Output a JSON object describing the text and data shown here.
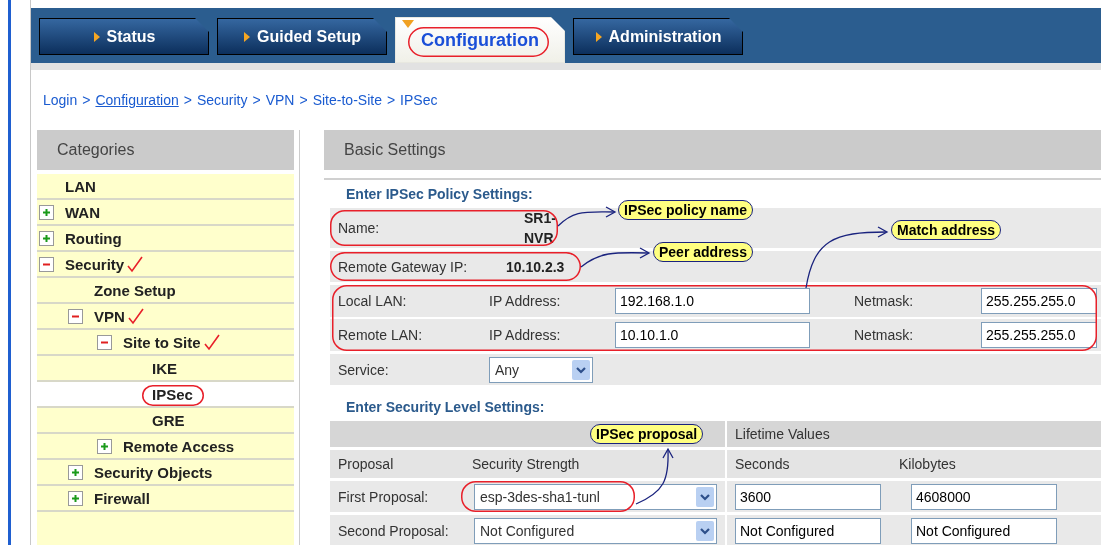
{
  "tabs": [
    {
      "label": "Status",
      "selected": false,
      "circled": false
    },
    {
      "label": "Guided Setup",
      "selected": false,
      "circled": false
    },
    {
      "label": "Configuration",
      "selected": true,
      "circled": true
    },
    {
      "label": "Administration",
      "selected": false,
      "circled": false
    }
  ],
  "breadcrumb": {
    "separator": ">",
    "items": [
      {
        "text": "Login",
        "underlined": false
      },
      {
        "text": "Configuration",
        "underlined": true
      },
      {
        "text": "Security",
        "underlined": false
      },
      {
        "text": "VPN",
        "underlined": false
      },
      {
        "text": "Site-to-Site",
        "underlined": false
      },
      {
        "text": "IPSec",
        "underlined": false
      }
    ]
  },
  "categories": {
    "title": "Categories",
    "items": [
      {
        "label": "LAN",
        "kind": "leaf",
        "ticked": false,
        "selected": false,
        "circled": false
      },
      {
        "label": "WAN",
        "kind": "folder",
        "expanded": false,
        "ticked": false,
        "selected": false,
        "circled": false
      },
      {
        "label": "Routing",
        "kind": "folder",
        "expanded": false,
        "ticked": false,
        "selected": false,
        "circled": false
      },
      {
        "label": "Security",
        "kind": "folder",
        "expanded": true,
        "ticked": true,
        "selected": false,
        "circled": false,
        "children": [
          {
            "label": "Zone Setup",
            "kind": "leaf",
            "ticked": false,
            "selected": false,
            "circled": false
          },
          {
            "label": "VPN",
            "kind": "folder",
            "expanded": true,
            "ticked": true,
            "selected": false,
            "circled": false,
            "children": [
              {
                "label": "Site to Site",
                "kind": "folder",
                "expanded": true,
                "ticked": true,
                "selected": false,
                "circled": false,
                "children": [
                  {
                    "label": "IKE",
                    "kind": "leaf",
                    "ticked": false,
                    "selected": false,
                    "circled": false
                  },
                  {
                    "label": "IPSec",
                    "kind": "leaf",
                    "ticked": false,
                    "selected": true,
                    "circled": true
                  },
                  {
                    "label": "GRE",
                    "kind": "leaf",
                    "ticked": false,
                    "selected": false,
                    "circled": false
                  }
                ]
              },
              {
                "label": "Remote Access",
                "kind": "folder",
                "expanded": false,
                "ticked": false,
                "selected": false,
                "circled": false
              }
            ]
          },
          {
            "label": "Security Objects",
            "kind": "folder",
            "expanded": false,
            "ticked": false,
            "selected": false,
            "circled": false
          },
          {
            "label": "Firewall",
            "kind": "folder",
            "expanded": false,
            "ticked": false,
            "selected": false,
            "circled": false
          }
        ]
      }
    ]
  },
  "basic_settings": {
    "title": "Basic Settings",
    "policy_section": {
      "title": "Enter IPSec Policy Settings:",
      "name": {
        "label": "Name:",
        "value": "SR1-NVR",
        "circled": true
      },
      "remote_gateway": {
        "label": "Remote Gateway IP:",
        "value": "10.10.2.3",
        "circled": true
      },
      "lans": {
        "circled": true,
        "rows": [
          {
            "label": "Local LAN:",
            "ip_label": "IP Address:",
            "ip": "192.168.1.0",
            "netmask_label": "Netmask:",
            "netmask": "255.255.255.0"
          },
          {
            "label": "Remote LAN:",
            "ip_label": "IP Address:",
            "ip": "10.10.1.0",
            "netmask_label": "Netmask:",
            "netmask": "255.255.255.0"
          }
        ]
      },
      "service": {
        "label": "Service:",
        "value": "Any"
      }
    },
    "security_section": {
      "title": "Enter Security Level Settings:",
      "group_heading": "Lifetime Values",
      "columns": [
        "Proposal",
        "Security Strength",
        "Seconds",
        "Kilobytes"
      ],
      "proposals": [
        {
          "label": "First Proposal:",
          "strength": "esp-3des-sha1-tunl",
          "seconds": "3600",
          "kilobytes": "4608000",
          "circled": true
        },
        {
          "label": "Second Proposal:",
          "strength": "Not Configured",
          "seconds": "Not Configured",
          "kilobytes": "Not Configured",
          "circled": false
        }
      ]
    },
    "callouts": [
      {
        "text": "IPSec policy name"
      },
      {
        "text": "Peer address"
      },
      {
        "text": "Match address"
      },
      {
        "text": "IPSec proposal"
      }
    ]
  }
}
